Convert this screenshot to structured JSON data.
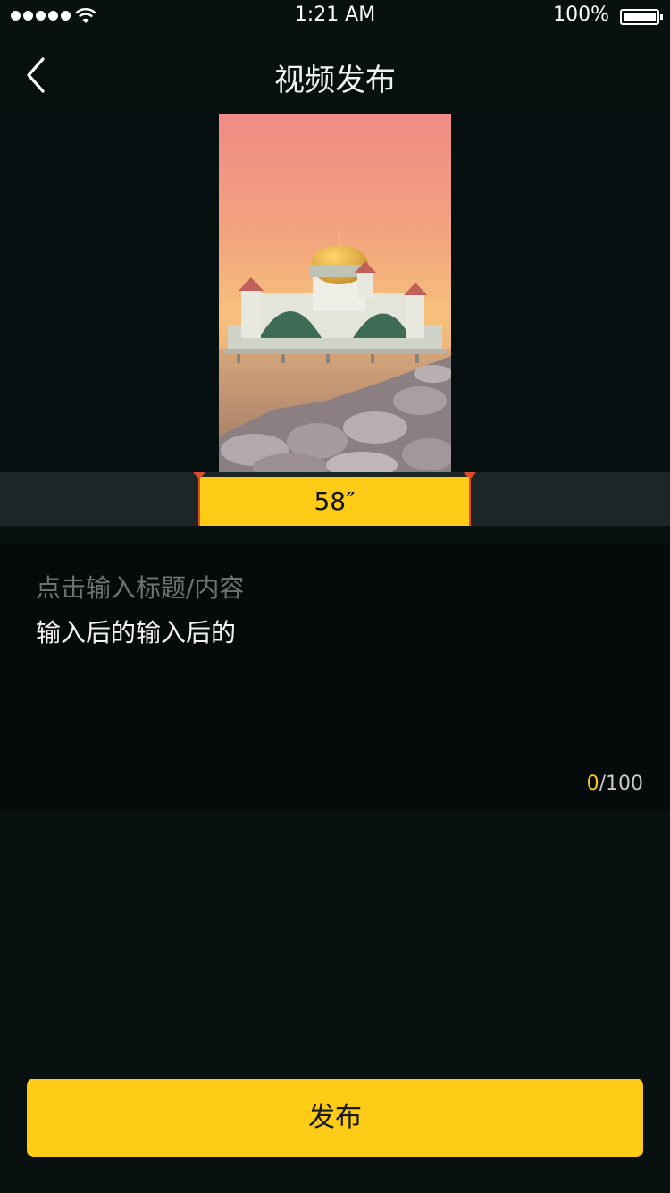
{
  "status_bar": {
    "time": "1:21 AM",
    "battery_percent": "100%",
    "battery_level": 1.0,
    "signal_dots": 5
  },
  "nav": {
    "back_icon": "chevron-left-icon",
    "title": "视频发布"
  },
  "preview": {
    "image_subject": "mosque-at-sunset-on-rocky-shore"
  },
  "timeline": {
    "duration_label": "58″"
  },
  "input": {
    "placeholder": "点击输入标题/内容",
    "value": "输入后的输入后的",
    "count_current": "0",
    "count_max": "/100"
  },
  "publish": {
    "label": "发布"
  },
  "colors": {
    "background": "#081010",
    "accent": "#fecb16",
    "trim_handle": "#e24a2c",
    "timeline_bg": "#1d2626"
  }
}
